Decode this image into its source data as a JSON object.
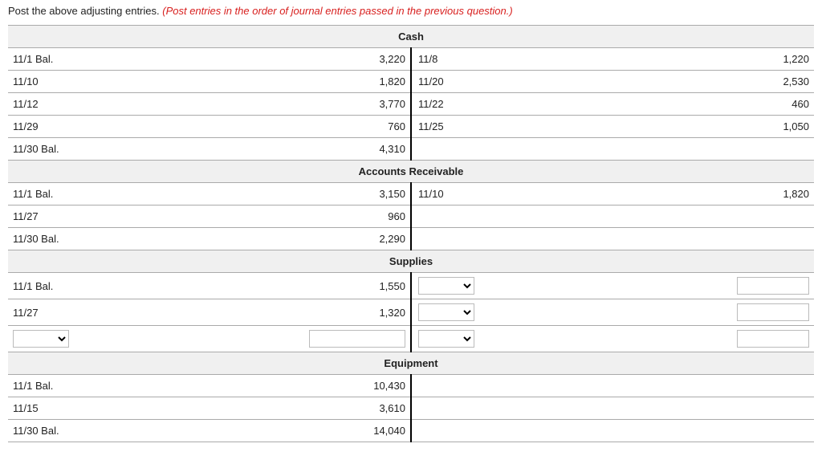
{
  "instruction": {
    "prefix": "Post the above adjusting entries. ",
    "note": "(Post entries in the order of journal entries passed in the previous question.)"
  },
  "accounts": [
    {
      "title": "Cash",
      "rows": [
        {
          "dl": "11/1 Bal.",
          "da": "3,220",
          "cl": "11/8",
          "ca": "1,220"
        },
        {
          "dl": "11/10",
          "da": "1,820",
          "cl": "11/20",
          "ca": "2,530"
        },
        {
          "dl": "11/12",
          "da": "3,770",
          "cl": "11/22",
          "ca": "460"
        },
        {
          "dl": "11/29",
          "da": "760",
          "cl": "11/25",
          "ca": "1,050"
        },
        {
          "dl": "11/30 Bal.",
          "da": "4,310",
          "cl": "",
          "ca": ""
        }
      ]
    },
    {
      "title": "Accounts Receivable",
      "rows": [
        {
          "dl": "11/1 Bal.",
          "da": "3,150",
          "cl": "11/10",
          "ca": "1,820"
        },
        {
          "dl": "11/27",
          "da": "960",
          "cl": "",
          "ca": ""
        },
        {
          "dl": "11/30 Bal.",
          "da": "2,290",
          "cl": "",
          "ca": ""
        }
      ]
    },
    {
      "title": "Supplies",
      "rows": [
        {
          "dl": "11/1 Bal.",
          "da": "1,550",
          "cl_sel": true,
          "ca_inp": true
        },
        {
          "dl": "11/27",
          "da": "1,320",
          "cl_sel": true,
          "ca_inp": true
        },
        {
          "dl_sel": true,
          "da_inp": true,
          "cl_sel": true,
          "ca_inp": true
        }
      ]
    },
    {
      "title": "Equipment",
      "rows": [
        {
          "dl": "11/1 Bal.",
          "da": "10,430",
          "cl": "",
          "ca": ""
        },
        {
          "dl": "11/15",
          "da": "3,610",
          "cl": "",
          "ca": ""
        },
        {
          "dl": "11/30 Bal.",
          "da": "14,040",
          "cl": "",
          "ca": ""
        }
      ]
    }
  ]
}
